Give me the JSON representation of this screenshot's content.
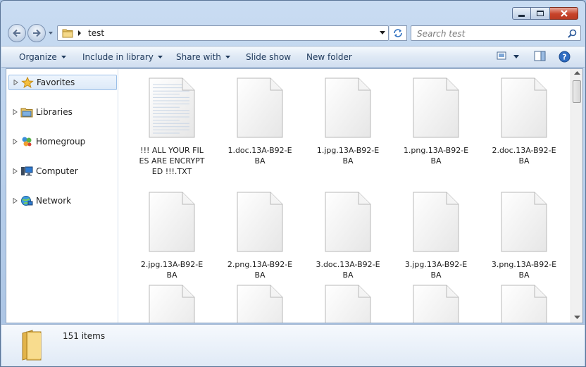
{
  "window": {
    "caption_buttons": {
      "minimize": "minimize",
      "maximize": "maximize",
      "close": "close"
    }
  },
  "address": {
    "path": "test",
    "search_placeholder": "Search test"
  },
  "toolbar": {
    "organize": "Organize",
    "include_in_library": "Include in library",
    "share_with": "Share with",
    "slide_show": "Slide show",
    "new_folder": "New folder"
  },
  "nav_pane": {
    "items": [
      {
        "label": "Favorites",
        "icon": "star-icon",
        "selected": true
      },
      {
        "label": "Libraries",
        "icon": "libraries-icon"
      },
      {
        "label": "Homegroup",
        "icon": "homegroup-icon"
      },
      {
        "label": "Computer",
        "icon": "computer-icon"
      },
      {
        "label": "Network",
        "icon": "network-icon"
      }
    ]
  },
  "files": [
    {
      "name": "!!! ALL YOUR FILES ARE ENCRYPTED !!!.TXT",
      "icon": "text-file-icon"
    },
    {
      "name": "1.doc.13A-B92-EBA",
      "icon": "blank-file-icon"
    },
    {
      "name": "1.jpg.13A-B92-EBA",
      "icon": "blank-file-icon"
    },
    {
      "name": "1.png.13A-B92-EBA",
      "icon": "blank-file-icon"
    },
    {
      "name": "2.doc.13A-B92-EBA",
      "icon": "blank-file-icon"
    },
    {
      "name": "2.jpg.13A-B92-EBA",
      "icon": "blank-file-icon"
    },
    {
      "name": "2.png.13A-B92-EBA",
      "icon": "blank-file-icon"
    },
    {
      "name": "3.doc.13A-B92-EBA",
      "icon": "blank-file-icon"
    },
    {
      "name": "3.jpg.13A-B92-EBA",
      "icon": "blank-file-icon"
    },
    {
      "name": "3.png.13A-B92-EBA",
      "icon": "blank-file-icon"
    },
    {
      "name": "",
      "icon": "blank-file-icon"
    },
    {
      "name": "",
      "icon": "blank-file-icon"
    },
    {
      "name": "",
      "icon": "blank-file-icon"
    },
    {
      "name": "",
      "icon": "blank-file-icon"
    },
    {
      "name": "",
      "icon": "blank-file-icon"
    }
  ],
  "status": {
    "item_count": "151 items"
  },
  "colors": {
    "frame": "#c9dcf2",
    "toolbar": "#dfe9f5",
    "selection": "#dce9f8",
    "close": "#c8432a"
  }
}
